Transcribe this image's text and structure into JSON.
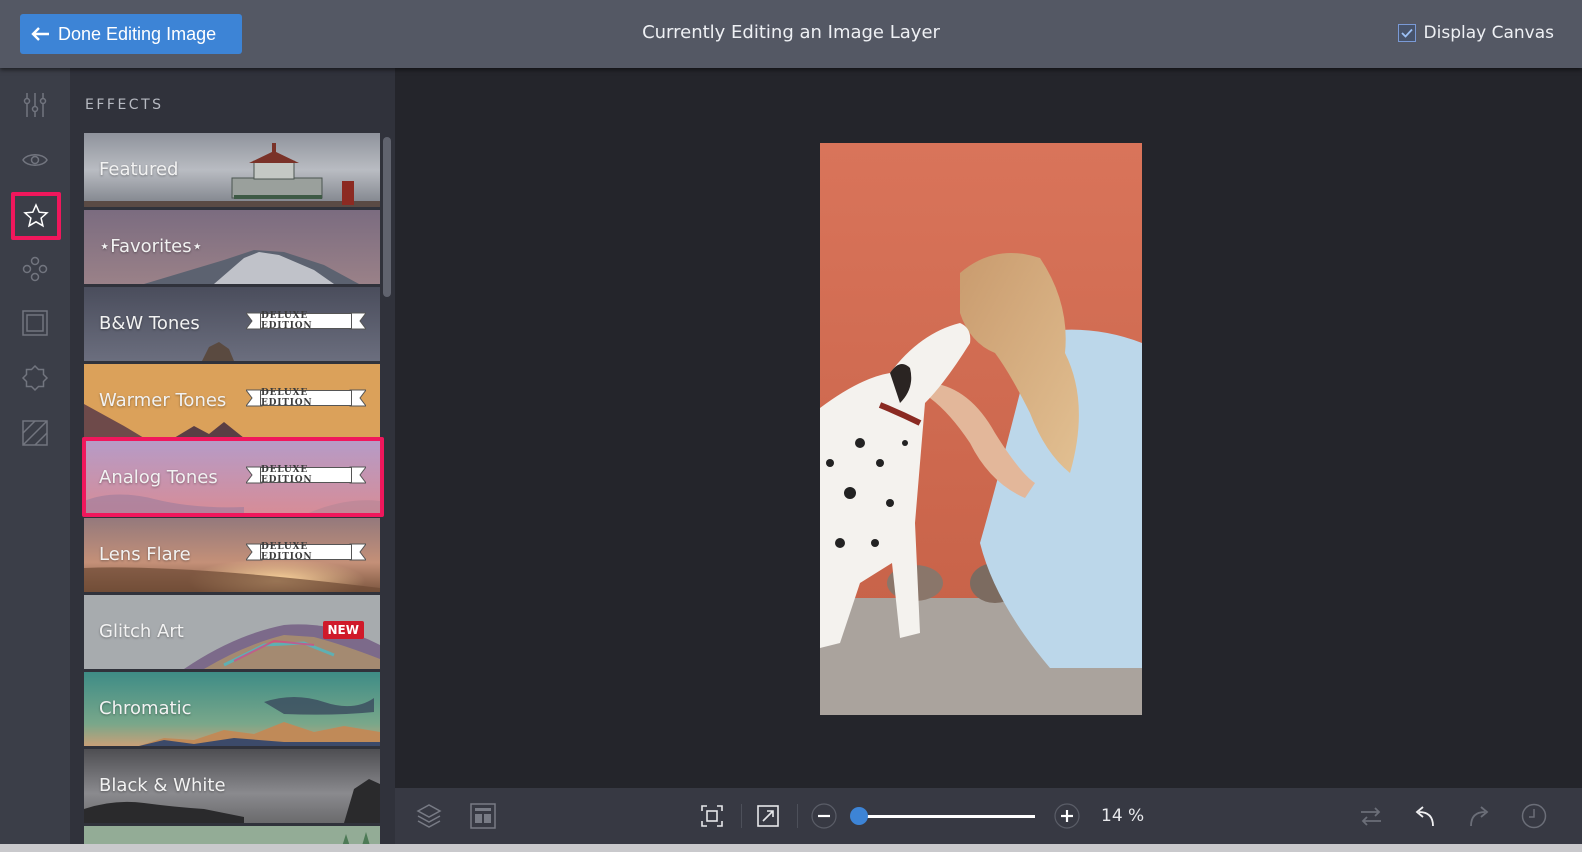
{
  "topbar": {
    "done_button": "Done Editing Image",
    "title": "Currently Editing an Image Layer",
    "display_canvas": {
      "label": "Display Canvas",
      "checked": true
    }
  },
  "iconbar": {
    "items": [
      {
        "name": "adjustments",
        "icon": "sliders-icon",
        "active": false
      },
      {
        "name": "view",
        "icon": "eye-icon",
        "active": false
      },
      {
        "name": "effects",
        "icon": "star-icon",
        "active": true
      },
      {
        "name": "elements",
        "icon": "circles-icon",
        "active": false
      },
      {
        "name": "frames",
        "icon": "frame-icon",
        "active": false
      },
      {
        "name": "shapes",
        "icon": "badge-icon",
        "active": false
      },
      {
        "name": "textures",
        "icon": "texture-icon",
        "active": false
      }
    ]
  },
  "panel": {
    "title": "EFFECTS",
    "cards": [
      {
        "label": "Featured",
        "badge": ""
      },
      {
        "label": "⋆Favorites⋆",
        "badge": ""
      },
      {
        "label": "B&W Tones",
        "badge": "DELUXE EDITION"
      },
      {
        "label": "Warmer Tones",
        "badge": "DELUXE EDITION"
      },
      {
        "label": "Analog Tones",
        "badge": "DELUXE EDITION",
        "selected": true
      },
      {
        "label": "Lens Flare",
        "badge": "DELUXE EDITION"
      },
      {
        "label": "Glitch Art",
        "badge": "NEW"
      },
      {
        "label": "Chromatic",
        "badge": ""
      },
      {
        "label": "Black & White",
        "badge": ""
      }
    ]
  },
  "bottombar": {
    "zoom_percent": "14 %",
    "zoom_slider_fraction": 0.02
  },
  "colors": {
    "accent": "#3d84d6",
    "highlight": "#f0175c",
    "new_badge": "#d01a2a"
  }
}
